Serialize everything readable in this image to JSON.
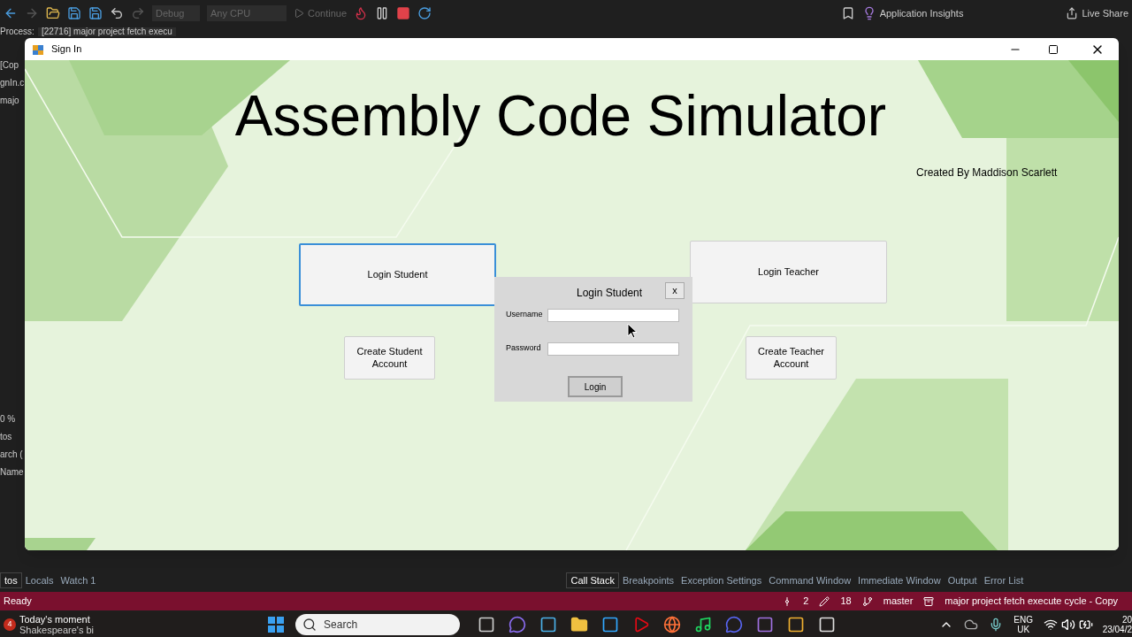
{
  "ide": {
    "toolbar": {
      "config": "Debug",
      "platform": "Any CPU",
      "continue": "Continue",
      "insights": "Application Insights",
      "live_share": "Live Share"
    },
    "process_label": "Process:",
    "process_value": "[22716] major project fetch execu",
    "left_fragments": [
      "[Cop",
      "gnIn.c",
      "majo",
      "0 %",
      "tos",
      "arch (",
      "Name"
    ],
    "bottom_tabs_left": [
      {
        "label": "tos",
        "selected": true
      },
      {
        "label": "Locals",
        "selected": false
      },
      {
        "label": "Watch 1",
        "selected": false
      }
    ],
    "bottom_tabs_right": [
      {
        "label": "Call Stack",
        "selected": true
      },
      {
        "label": "Breakpoints",
        "selected": false
      },
      {
        "label": "Exception Settings",
        "selected": false
      },
      {
        "label": "Command Window",
        "selected": false
      },
      {
        "label": "Immediate Window",
        "selected": false
      },
      {
        "label": "Output",
        "selected": false
      },
      {
        "label": "Error List",
        "selected": false
      }
    ],
    "status_bar": {
      "text": "Ready",
      "commits": "2",
      "edits": "18",
      "branch": "master",
      "repo": "major project fetch execute cycle - Copy"
    }
  },
  "window": {
    "title": "Sign In",
    "heading": "Assembly Code Simulator",
    "credit": "Created By Maddison Scarlett",
    "buttons": [
      {
        "label": "Login Student",
        "focused": true
      },
      {
        "label": "Login Teacher",
        "focused": false
      },
      {
        "label": "Create Student Account",
        "focused": false
      },
      {
        "label": "Create Teacher Account",
        "focused": false
      }
    ],
    "dialog": {
      "title": "Login Student",
      "close": "x",
      "fields": [
        {
          "label": "Username"
        },
        {
          "label": "Password"
        }
      ],
      "button": "Login"
    }
  },
  "taskbar": {
    "badge": "4",
    "news_title": "Today's moment",
    "news_sub": "Shakespeare's bi",
    "search_placeholder": "Search",
    "lang": "ENG",
    "region": "UK",
    "time": "20",
    "date": "23/04/2"
  }
}
